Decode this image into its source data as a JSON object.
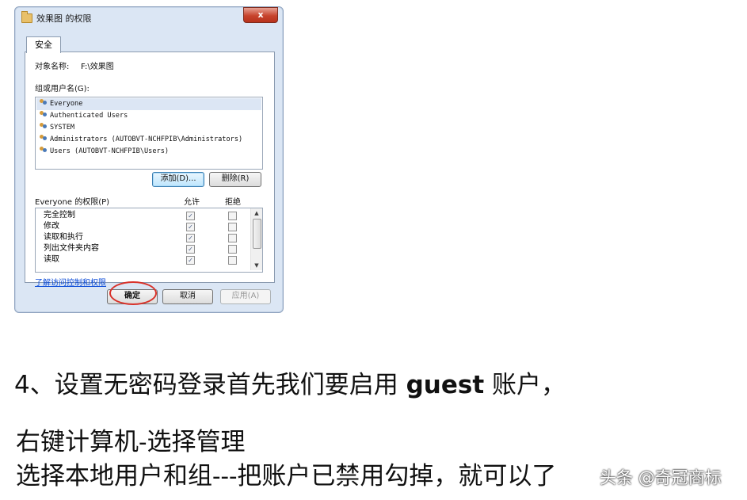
{
  "dialog": {
    "title": "效果图 的权限",
    "close_label": "x",
    "tab": "安全",
    "object_label": "对象名称:",
    "object_value": "F:\\效果图",
    "group_label": "组或用户名(G):",
    "users": [
      {
        "name": "Everyone",
        "selected": true
      },
      {
        "name": "Authenticated Users",
        "selected": false
      },
      {
        "name": "SYSTEM",
        "selected": false
      },
      {
        "name": "Administrators (AUTOBVT-NCHFPIB\\Administrators)",
        "selected": false
      },
      {
        "name": "Users (AUTOBVT-NCHFPIB\\Users)",
        "selected": false
      }
    ],
    "add_button": "添加(D)...",
    "remove_button": "删除(R)",
    "perm_header": "Everyone 的权限(P)",
    "allow_header": "允许",
    "deny_header": "拒绝",
    "permissions": [
      {
        "name": "完全控制",
        "allow": true,
        "deny": false
      },
      {
        "name": "修改",
        "allow": true,
        "deny": false
      },
      {
        "name": "读取和执行",
        "allow": true,
        "deny": false
      },
      {
        "name": "列出文件夹内容",
        "allow": true,
        "deny": false
      },
      {
        "name": "读取",
        "allow": true,
        "deny": false
      }
    ],
    "link": "了解访问控制和权限",
    "ok_button": "确定",
    "cancel_button": "取消",
    "apply_button": "应用(A)"
  },
  "text": {
    "headline_prefix": "4、设置无密码登录首先我们要启用 ",
    "headline_bold": "guest",
    "headline_suffix": " 账户，",
    "line2": "右键计算机-选择管理",
    "line3": "选择本地用户和组---把账户已禁用勾掉，就可以了",
    "watermark": "头条 @奇冠商标"
  },
  "colors": {
    "annotation_oval": "#d8322a",
    "link": "#0b4bd8"
  }
}
